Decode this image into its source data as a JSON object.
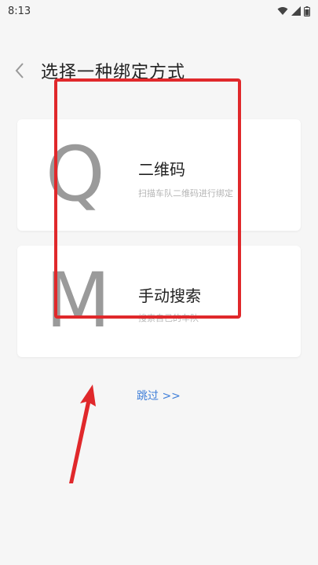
{
  "status_bar": {
    "time": "8:13",
    "icons": [
      "wifi-icon",
      "signal-icon",
      "battery-icon"
    ]
  },
  "header": {
    "title": "选择一种绑定方式"
  },
  "cards": [
    {
      "letter": "Q",
      "title": "二维码",
      "description": "扫描车队二维码进行绑定"
    },
    {
      "letter": "M",
      "title": "手动搜索",
      "description": "搜索自己的车队"
    }
  ],
  "skip": {
    "label": "跳过 >>"
  },
  "colors": {
    "background": "#f6f6f6",
    "card": "#ffffff",
    "link": "#3f7ed8",
    "annotation": "#e0282b"
  }
}
